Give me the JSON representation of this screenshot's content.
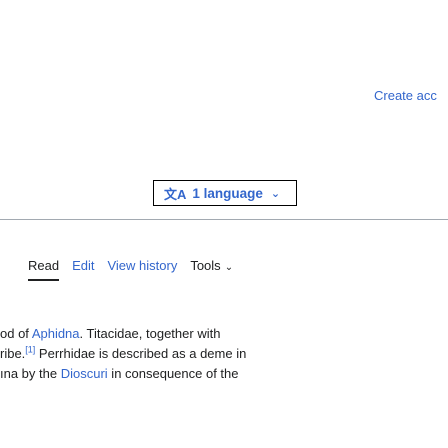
{
  "header": {
    "create_account": "Create acc"
  },
  "language_button": {
    "icon_glyph": "文A",
    "label": "1 language",
    "chevron": "⌄"
  },
  "tabs": [
    {
      "label": "Read",
      "active": true
    },
    {
      "label": "Edit"
    },
    {
      "label": "View history"
    },
    {
      "label": "Tools",
      "chevron": "⌄"
    }
  ],
  "article": {
    "line1": {
      "pre": "od of ",
      "link": "Aphidna",
      "post": ". Titacidae, together with"
    },
    "line2": {
      "pre": "ribe.",
      "ref": "[1]",
      "post": " Perrhidae is described as a deme in"
    },
    "line3": {
      "pre": "ına by the ",
      "link": "Dioscuri",
      "post": " in consequence of the"
    }
  },
  "colors": {
    "link": "#3366cc",
    "text": "#202122",
    "divider": "#a2a9b1"
  }
}
